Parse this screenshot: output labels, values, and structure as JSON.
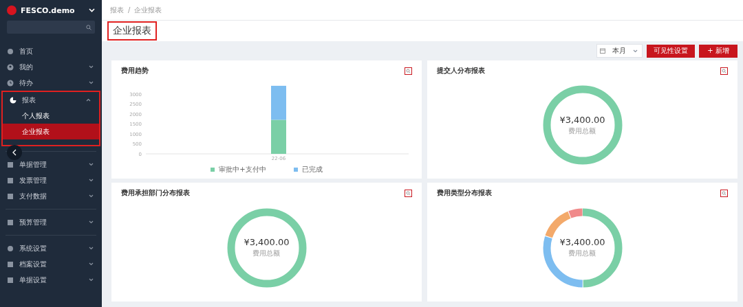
{
  "sidebar": {
    "brand": "FESCO.demo",
    "groups": [
      {
        "items": [
          {
            "label": "首页"
          },
          {
            "label": "我的",
            "expanded": false
          },
          {
            "label": "待办",
            "expanded": false
          },
          {
            "label": "报表",
            "expanded": true,
            "highlighted": true,
            "children": [
              {
                "label": "个人报表",
                "selected": false
              },
              {
                "label": "企业报表",
                "selected": true
              }
            ]
          }
        ]
      },
      {
        "items": [
          {
            "label": "单据管理",
            "expanded": false
          },
          {
            "label": "发票管理",
            "expanded": false
          },
          {
            "label": "支付数据",
            "expanded": false
          }
        ]
      },
      {
        "items": [
          {
            "label": "预算管理",
            "expanded": false
          }
        ]
      },
      {
        "items": [
          {
            "label": "系统设置",
            "expanded": false
          },
          {
            "label": "档案设置",
            "expanded": false
          },
          {
            "label": "单据设置",
            "expanded": false
          }
        ]
      }
    ]
  },
  "breadcrumb": {
    "items": [
      "报表",
      "企业报表"
    ],
    "separator": "/"
  },
  "title": {
    "text": "企业报表",
    "highlighted": true
  },
  "toolbar": {
    "period": "本月",
    "buttons": [
      "可见性设置",
      "+ 新增"
    ]
  },
  "cards": [
    {
      "title": "费用趋势",
      "kind": "bar",
      "chart_data": {
        "type": "bar",
        "stacked": true,
        "categories": [
          "22-06"
        ],
        "series": [
          {
            "name": "审批中+支付中",
            "color": "#7acfa6",
            "values": [
              1700
            ]
          },
          {
            "name": "已完成",
            "color": "#7dbdf0",
            "values": [
              1700
            ]
          }
        ],
        "ylim": [
          0,
          3500
        ],
        "yticks": [
          0,
          500,
          1000,
          1500,
          2000,
          2500,
          3000
        ]
      }
    },
    {
      "title": "提交人分布报表",
      "kind": "ring",
      "amount": "¥3,400.00",
      "caption": "费用总额"
    },
    {
      "title": "费用承担部门分布报表",
      "kind": "ring",
      "amount": "¥3,400.00",
      "caption": "费用总额"
    },
    {
      "title": "费用类型分布报表",
      "kind": "segmented",
      "amount": "¥3,400.00",
      "caption": "费用总额"
    }
  ]
}
